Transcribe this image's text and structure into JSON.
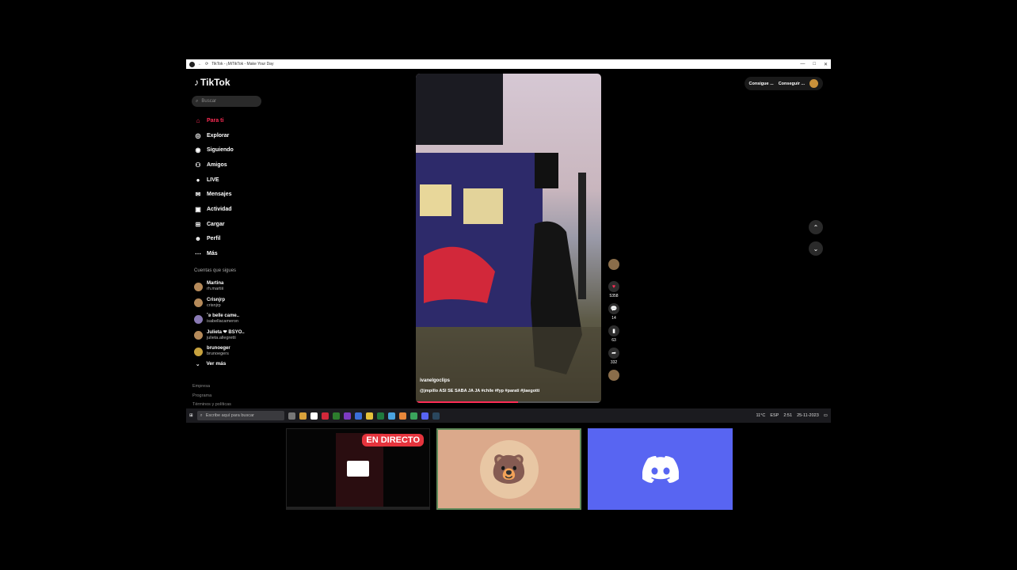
{
  "browser": {
    "tab_title": "TikTok - ¡MiTikTok - Make Your Day",
    "controls": [
      "—",
      "□",
      "✕"
    ]
  },
  "sidebar": {
    "logo": "TikTok",
    "search_placeholder": "Buscar",
    "nav": [
      {
        "label": "Para ti",
        "icon": "home-icon",
        "active": true
      },
      {
        "label": "Explorar",
        "icon": "compass-icon"
      },
      {
        "label": "Siguiendo",
        "icon": "following-icon"
      },
      {
        "label": "Amigos",
        "icon": "friends-icon"
      },
      {
        "label": "LIVE",
        "icon": "live-icon"
      },
      {
        "label": "Mensajes",
        "icon": "messages-icon"
      },
      {
        "label": "Actividad",
        "icon": "activity-icon"
      },
      {
        "label": "Cargar",
        "icon": "upload-icon"
      },
      {
        "label": "Perfil",
        "icon": "profile-icon"
      },
      {
        "label": "Más",
        "icon": "more-icon"
      }
    ],
    "following_heading": "Cuentas que sigues",
    "accounts": [
      {
        "name": "Martina",
        "handle": "rh.martiii"
      },
      {
        "name": "Crisnjrp",
        "handle": "crisnjrp"
      },
      {
        "name": "˚ʚ belle came..",
        "handle": "isabellacameron"
      },
      {
        "name": "Julieta ❤ BSYO..",
        "handle": "julieta.allegretti"
      },
      {
        "name": "brunoeger",
        "handle": "brunoegers"
      }
    ],
    "see_all": "Ver más",
    "footer": [
      "Empresa",
      "Programa",
      "Términos y políticas"
    ]
  },
  "video": {
    "username": "ivanelgoclips",
    "caption": "@jmpillo ASI SE SABA JA JA #chile #fyp #parati #jiaegotti",
    "progress": 0.55
  },
  "actions": [
    {
      "icon": "heart-icon",
      "count": "5358"
    },
    {
      "icon": "comment-icon",
      "count": "14"
    },
    {
      "icon": "bookmark-icon",
      "count": "63"
    },
    {
      "icon": "share-icon",
      "count": "332"
    }
  ],
  "top_right": {
    "btn1": "Consigue ...",
    "btn2": "Conseguir ..."
  },
  "taskbar": {
    "search_placeholder": "Escribe aquí para buscar",
    "weather": "11°C",
    "lang": "ESP",
    "time": "2:51",
    "date": "25-11-2023"
  },
  "overlay": {
    "live_badge": "EN DIRECTO"
  },
  "colors": {
    "accent": "#fe2c55",
    "discord": "#5865f2",
    "live": "#e5343d"
  }
}
